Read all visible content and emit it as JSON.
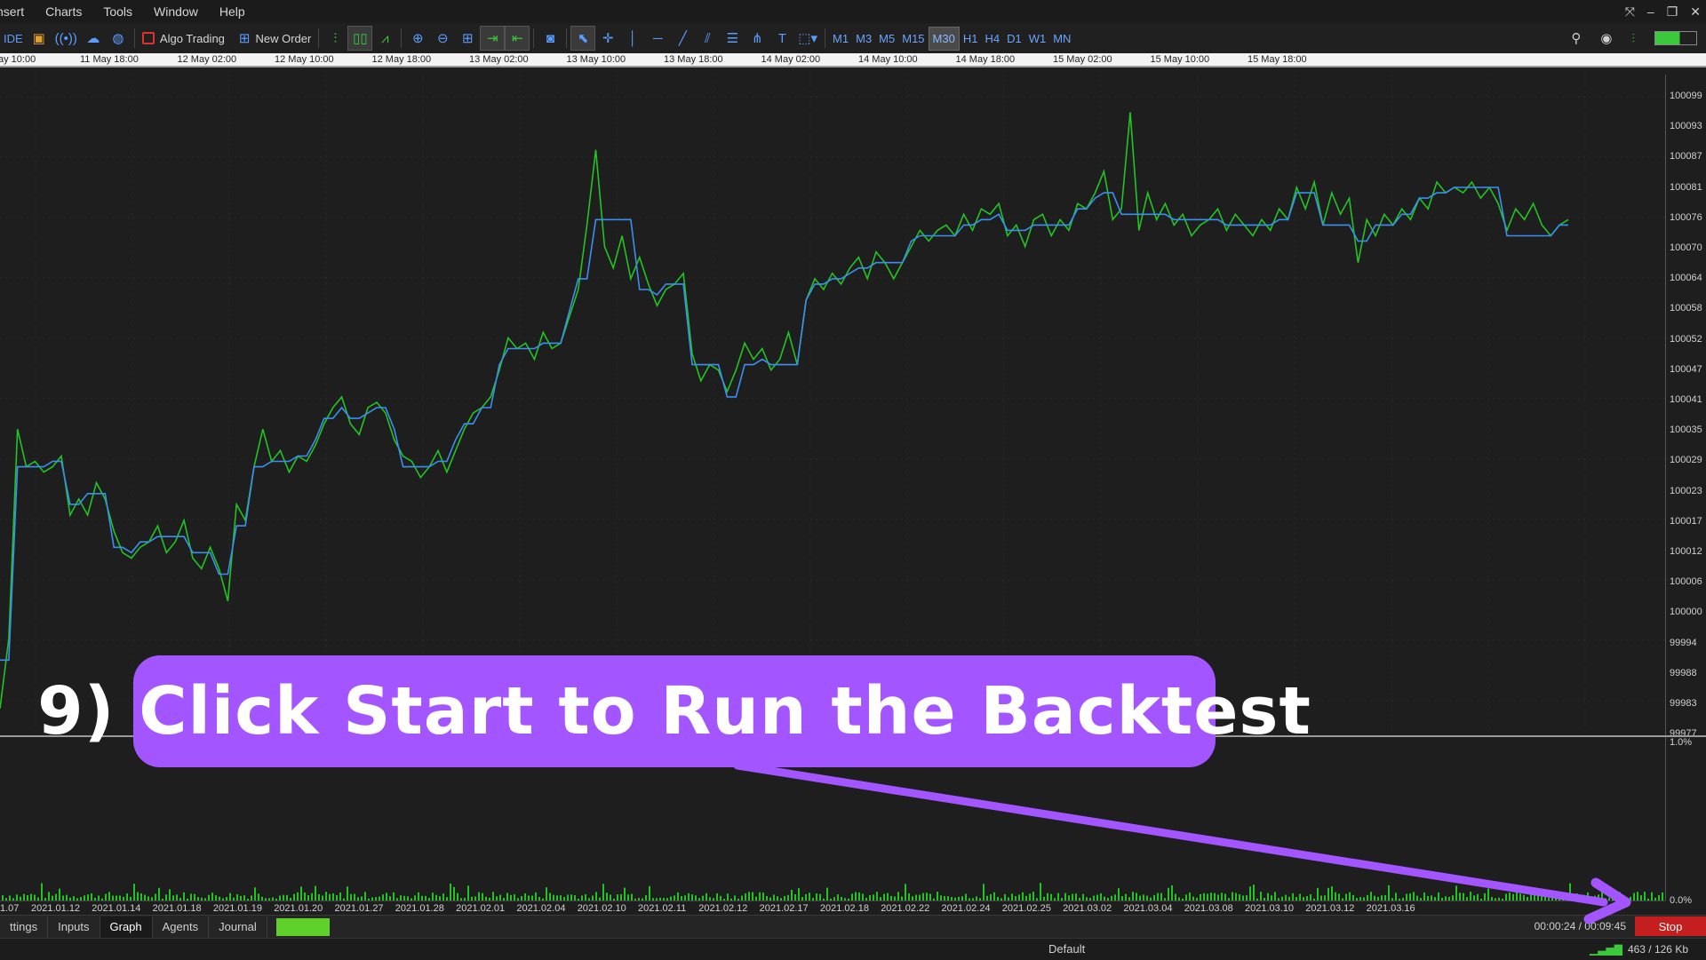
{
  "menubar": {
    "items": [
      "nsert",
      "Charts",
      "Tools",
      "Window",
      "Help"
    ]
  },
  "toolbar": {
    "ide_label": "IDE",
    "algo_trading_label": "Algo Trading",
    "new_order_label": "New Order",
    "timeframes": [
      "M1",
      "M3",
      "M5",
      "M15",
      "M30",
      "H1",
      "H4",
      "D1",
      "W1",
      "MN"
    ],
    "active_timeframe": "M30"
  },
  "time_ruler": {
    "labels": [
      "ay 10:00",
      "11 May 18:00",
      "12 May 02:00",
      "12 May 10:00",
      "12 May 18:00",
      "13 May 02:00",
      "13 May 10:00",
      "13 May 18:00",
      "14 May 02:00",
      "14 May 10:00",
      "14 May 18:00",
      "15 May 02:00",
      "15 May 10:00",
      "15 May 18:00"
    ]
  },
  "price_scale": {
    "labels": [
      "100099",
      "100093",
      "100087",
      "100081",
      "100076",
      "100070",
      "100064",
      "100058",
      "100052",
      "100047",
      "100041",
      "100035",
      "100029",
      "100023",
      "100017",
      "100012",
      "100006",
      "100000",
      "99994",
      "99988",
      "99983",
      "99977"
    ],
    "sub_labels": [
      "1.0%",
      "0.0%"
    ]
  },
  "date_axis": {
    "labels": [
      "1.07",
      "2021.01.12",
      "2021.01.14",
      "2021.01.18",
      "2021.01.19",
      "2021.01.20",
      "2021.01.27",
      "2021.01.28",
      "2021.02.01",
      "2021.02.04",
      "2021.02.10",
      "2021.02.11",
      "2021.02.12",
      "2021.02.17",
      "2021.02.18",
      "2021.02.22",
      "2021.02.24",
      "2021.02.25",
      "2021.03.02",
      "2021.03.04",
      "2021.03.08",
      "2021.03.10",
      "2021.03.12",
      "2021.03.16"
    ]
  },
  "chart_data": {
    "type": "line",
    "ylim": [
      99977,
      100100
    ],
    "series": [
      {
        "color": "#22c322",
        "x": [
          0,
          1,
          2,
          3,
          4,
          5,
          6,
          7,
          8,
          9,
          10,
          11,
          12,
          13,
          14,
          15,
          16,
          17,
          18,
          19,
          20,
          21,
          22,
          23,
          24,
          25,
          26,
          27,
          28,
          29,
          30,
          31,
          32,
          33,
          34,
          35,
          36,
          37,
          38,
          39,
          40,
          41,
          42,
          43,
          44,
          45,
          46,
          47,
          48,
          49,
          50,
          51,
          52,
          53,
          54,
          55,
          56,
          57,
          58,
          59,
          60,
          61,
          62,
          63,
          64,
          65,
          66,
          67,
          68,
          69,
          70,
          71,
          72,
          73,
          74,
          75,
          76,
          77,
          78,
          79,
          80,
          81,
          82,
          83,
          84,
          85,
          86,
          87,
          88,
          89,
          90,
          91,
          92,
          93,
          94,
          95,
          96,
          97,
          98,
          99,
          100,
          101,
          102,
          103,
          104,
          105,
          106,
          107,
          108,
          109,
          110,
          111,
          112,
          113,
          114,
          115,
          116,
          117,
          118,
          119,
          120,
          121,
          122,
          123,
          124,
          125,
          126,
          127,
          128,
          129,
          130,
          131,
          132,
          133,
          134,
          135,
          136,
          137,
          138,
          139,
          140,
          141,
          142,
          143,
          144,
          145,
          146,
          147,
          148,
          149,
          150,
          151,
          152,
          153,
          154,
          155,
          156,
          157,
          158,
          159,
          160,
          161,
          162,
          163,
          164,
          165,
          166,
          167,
          168,
          169,
          170,
          171,
          172,
          173,
          174,
          175,
          176,
          177,
          178,
          179
        ],
        "values": [
          99982,
          99995,
          100034,
          100027,
          100028,
          100026,
          100027,
          100029,
          100018,
          100021,
          100018,
          100024,
          100021,
          100015,
          100011,
          100010,
          100012,
          100013,
          100016,
          100011,
          100013,
          100017,
          100010,
          100008,
          100012,
          100008,
          100002,
          100020,
          100017,
          100027,
          100034,
          100028,
          100030,
          100026,
          100029,
          100028,
          100031,
          100035,
          100038,
          100040,
          100035,
          100033,
          100038,
          100039,
          100037,
          100032,
          100029,
          100028,
          100025,
          100027,
          100030,
          100026,
          100030,
          100034,
          100037,
          100038,
          100040,
          100045,
          100051,
          100049,
          100050,
          100047,
          100052,
          100049,
          100050,
          100055,
          100060,
          100072,
          100086,
          100068,
          100064,
          100070,
          100062,
          100066,
          100061,
          100057,
          100060,
          100061,
          100063,
          100048,
          100043,
          100046,
          100045,
          100041,
          100045,
          100050,
          100047,
          100049,
          100045,
          100047,
          100052,
          100046,
          100058,
          100062,
          100060,
          100063,
          100061,
          100064,
          100066,
          100062,
          100067,
          100065,
          100062,
          100065,
          100068,
          100071,
          100069,
          100071,
          100072,
          100070,
          100074,
          100071,
          100075,
          100074,
          100076,
          100070,
          100072,
          100068,
          100073,
          100074,
          100070,
          100073,
          100071,
          100076,
          100075,
          100078,
          100082,
          100073,
          100075,
          100093,
          100071,
          100078,
          100073,
          100076,
          100072,
          100074,
          100070,
          100072,
          100073,
          100075,
          100071,
          100074,
          100072,
          100070,
          100073,
          100071,
          100075,
          100073,
          100079,
          100075,
          100080,
          100072,
          100078,
          100074,
          100077,
          100065,
          100073,
          100070,
          100074,
          100072,
          100075,
          100073,
          100077,
          100075,
          100080,
          100078,
          100079,
          100078,
          100080,
          100077,
          100079,
          100076,
          100071,
          100075,
          100073,
          100076,
          100072,
          100070,
          100072,
          100073
        ]
      },
      {
        "color": "#3a8ff0",
        "x": [
          0,
          1,
          2,
          3,
          4,
          5,
          6,
          7,
          8,
          9,
          10,
          11,
          12,
          13,
          14,
          15,
          16,
          17,
          18,
          19,
          20,
          21,
          22,
          23,
          24,
          25,
          26,
          27,
          28,
          29,
          30,
          31,
          32,
          33,
          34,
          35,
          36,
          37,
          38,
          39,
          40,
          41,
          42,
          43,
          44,
          45,
          46,
          47,
          48,
          49,
          50,
          51,
          52,
          53,
          54,
          55,
          56,
          57,
          58,
          59,
          60,
          61,
          62,
          63,
          64,
          65,
          66,
          67,
          68,
          69,
          70,
          71,
          72,
          73,
          74,
          75,
          76,
          77,
          78,
          79,
          80,
          81,
          82,
          83,
          84,
          85,
          86,
          87,
          88,
          89,
          90,
          91,
          92,
          93,
          94,
          95,
          96,
          97,
          98,
          99,
          100,
          101,
          102,
          103,
          104,
          105,
          106,
          107,
          108,
          109,
          110,
          111,
          112,
          113,
          114,
          115,
          116,
          117,
          118,
          119,
          120,
          121,
          122,
          123,
          124,
          125,
          126,
          127,
          128,
          129,
          130,
          131,
          132,
          133,
          134,
          135,
          136,
          137,
          138,
          139,
          140,
          141,
          142,
          143,
          144,
          145,
          146,
          147,
          148,
          149,
          150,
          151,
          152,
          153,
          154,
          155,
          156,
          157,
          158,
          159,
          160,
          161,
          162,
          163,
          164,
          165,
          166,
          167,
          168,
          169,
          170,
          171,
          172,
          173,
          174,
          175,
          176,
          177,
          178,
          179
        ],
        "values": [
          99991,
          99991,
          100027,
          100027,
          100027,
          100027,
          100028,
          100028,
          100020,
          100020,
          100022,
          100022,
          100022,
          100012,
          100012,
          100011,
          100013,
          100013,
          100014,
          100014,
          100014,
          100014,
          100011,
          100011,
          100011,
          100007,
          100007,
          100016,
          100016,
          100027,
          100027,
          100028,
          100028,
          100028,
          100029,
          100029,
          100032,
          100036,
          100036,
          100038,
          100036,
          100036,
          100037,
          100038,
          100038,
          100034,
          100027,
          100027,
          100027,
          100027,
          100028,
          100028,
          100032,
          100035,
          100035,
          100038,
          100038,
          100046,
          100049,
          100049,
          100049,
          100049,
          100050,
          100050,
          100050,
          100056,
          100062,
          100062,
          100073,
          100073,
          100073,
          100073,
          100073,
          100060,
          100060,
          100059,
          100061,
          100061,
          100061,
          100046,
          100046,
          100046,
          100046,
          100040,
          100040,
          100046,
          100046,
          100047,
          100046,
          100046,
          100046,
          100046,
          100058,
          100061,
          100061,
          100062,
          100062,
          100063,
          100064,
          100064,
          100065,
          100065,
          100065,
          100065,
          100069,
          100070,
          100070,
          100070,
          100070,
          100070,
          100072,
          100072,
          100073,
          100073,
          100074,
          100071,
          100071,
          100071,
          100072,
          100072,
          100072,
          100072,
          100072,
          100075,
          100075,
          100077,
          100078,
          100078,
          100074,
          100074,
          100074,
          100074,
          100074,
          100074,
          100073,
          100073,
          100073,
          100073,
          100073,
          100073,
          100072,
          100072,
          100072,
          100072,
          100072,
          100072,
          100073,
          100073,
          100078,
          100078,
          100078,
          100072,
          100072,
          100072,
          100072,
          100069,
          100069,
          100072,
          100072,
          100072,
          100074,
          100074,
          100077,
          100077,
          100078,
          100078,
          100079,
          100079,
          100079,
          100079,
          100079,
          100079,
          100070,
          100070,
          100070,
          100070,
          100070,
          100070,
          100072,
          100072
        ]
      }
    ]
  },
  "tabs": {
    "items": [
      "ttings",
      "Inputs",
      "Graph",
      "Agents",
      "Journal"
    ],
    "active": "Graph",
    "progress_percent": 100
  },
  "timer": {
    "text": "00:00:24 / 00:09:45"
  },
  "stop_button": {
    "label": "Stop"
  },
  "statusbar": {
    "profile": "Default",
    "traffic": "463 / 126 Kb"
  },
  "callout": {
    "text": "9) Click Start to Run the Backtest"
  },
  "colors": {
    "callout": "#a356ff",
    "stop": "#c41e1e",
    "progress": "#5fd12a",
    "accent": "#5b9cff"
  },
  "icons": {
    "toolbar": [
      "ide-icon",
      "market-bag-icon",
      "signals-icon",
      "cloud-icon",
      "vps-icon",
      "algo-trading-icon",
      "new-order-icon",
      "bar-chart-icon",
      "candlestick-icon",
      "line-chart-icon",
      "zoom-in-icon",
      "zoom-out-icon",
      "tile-windows-icon",
      "autoscroll-icon",
      "chart-shift-icon",
      "screenshot-icon",
      "cursor-icon",
      "crosshair-icon",
      "vertical-line-icon",
      "horizontal-line-icon",
      "trendline-icon",
      "equidistant-channel-icon",
      "fibonacci-icon",
      "andrews-pitchfork-icon",
      "text-icon",
      "shapes-icon"
    ]
  }
}
